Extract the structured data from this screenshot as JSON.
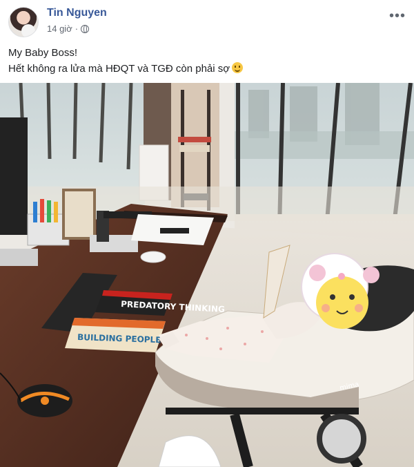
{
  "post": {
    "author": "Tin Nguyen",
    "time": "14 giờ",
    "separator": "·",
    "more_label": "•••",
    "text_line1": "My Baby Boss!",
    "text_line2": "Hết không ra lửa mà HĐQT và TGĐ còn phải sợ",
    "privacy_icon": "globe-icon",
    "emoji_icon": "smiley-icon"
  },
  "photo": {
    "book1_title": "PREDATORY THINKING",
    "book2_title": "BUILDING PEOPLE",
    "stroller_brand": "mima",
    "colors": {
      "link": "#385898",
      "meta": "#616770"
    }
  }
}
